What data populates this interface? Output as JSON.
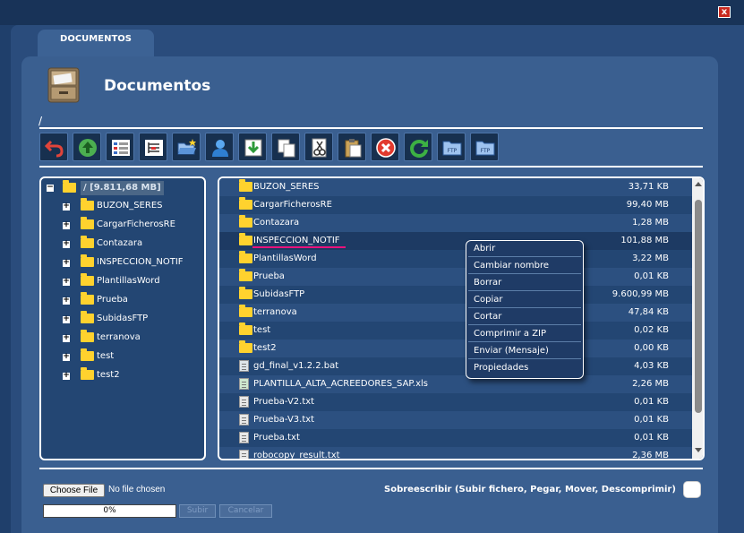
{
  "window": {
    "close_glyph": "x"
  },
  "tab": {
    "label": "DOCUMENTOS"
  },
  "header": {
    "title": "Documentos",
    "icon": "file-cabinet-icon"
  },
  "path": "/",
  "toolbar": [
    {
      "name": "back",
      "icon": "undo-arrow-icon"
    },
    {
      "name": "up",
      "icon": "up-arrow-icon"
    },
    {
      "name": "view-details",
      "icon": "details-view-icon"
    },
    {
      "name": "view-list",
      "icon": "list-view-icon"
    },
    {
      "name": "open-folder",
      "icon": "open-folder-icon"
    },
    {
      "name": "user",
      "icon": "user-icon"
    },
    {
      "name": "download",
      "icon": "download-icon"
    },
    {
      "name": "copy",
      "icon": "copy-icon"
    },
    {
      "name": "cut",
      "icon": "scissors-icon"
    },
    {
      "name": "paste",
      "icon": "paste-icon"
    },
    {
      "name": "delete",
      "icon": "delete-icon"
    },
    {
      "name": "refresh",
      "icon": "refresh-icon"
    },
    {
      "name": "ftp-1",
      "icon": "ftp-folder-icon",
      "label": "FTP"
    },
    {
      "name": "ftp-2",
      "icon": "ftp-folder-icon",
      "label": "FTP"
    }
  ],
  "tree": {
    "root_label": "/ [9.811,68 MB]",
    "expand_glyph": "+",
    "collapse_glyph": "−",
    "items": [
      "BUZON_SERES",
      "CargarFicherosRE",
      "Contazara",
      "INSPECCION_NOTIF",
      "PlantillasWord",
      "Prueba",
      "SubidasFTP",
      "terranova",
      "test",
      "test2"
    ]
  },
  "files": [
    {
      "name": "BUZON_SERES",
      "size": "33,71 KB",
      "type": "folder"
    },
    {
      "name": "CargarFicherosRE",
      "size": "99,40 MB",
      "type": "folder"
    },
    {
      "name": "Contazara",
      "size": "1,28 MB",
      "type": "folder"
    },
    {
      "name": "INSPECCION_NOTIF",
      "size": "101,88 MB",
      "type": "folder",
      "selected": true
    },
    {
      "name": "PlantillasWord",
      "size": "3,22 MB",
      "type": "folder"
    },
    {
      "name": "Prueba",
      "size": "0,01 KB",
      "type": "folder"
    },
    {
      "name": "SubidasFTP",
      "size": "9.600,99 MB",
      "type": "folder"
    },
    {
      "name": "terranova",
      "size": "47,84 KB",
      "type": "folder"
    },
    {
      "name": "test",
      "size": "0,02 KB",
      "type": "folder"
    },
    {
      "name": "test2",
      "size": "0,00 KB",
      "type": "folder"
    },
    {
      "name": "gd_final_v1.2.2.bat",
      "size": "4,03 KB",
      "type": "bat"
    },
    {
      "name": "PLANTILLA_ALTA_ACREEDORES_SAP.xls",
      "size": "2,26 MB",
      "type": "xls"
    },
    {
      "name": "Prueba-V2.txt",
      "size": "0,01 KB",
      "type": "txt"
    },
    {
      "name": "Prueba-V3.txt",
      "size": "0,01 KB",
      "type": "txt"
    },
    {
      "name": "Prueba.txt",
      "size": "0,01 KB",
      "type": "txt"
    },
    {
      "name": "robocopy_result.txt",
      "size": "2,36 MB",
      "type": "txt"
    }
  ],
  "context_menu": [
    "Abrir",
    "Cambiar nombre",
    "Borrar",
    "Copiar",
    "Cortar",
    "Comprimir a ZIP",
    "Enviar (Mensaje)",
    "Propiedades"
  ],
  "upload": {
    "choose_label": "Choose File",
    "no_file": "No file chosen",
    "progress": "0%",
    "progress_value": 0,
    "submit_label": "Subir",
    "cancel_label": "Cancelar",
    "overwrite_label": "Sobreescribir (Subir fichero, Pegar, Mover, Descomprimir)",
    "overwrite_checked": false
  },
  "colors": {
    "background": "#1f3f6b",
    "panel": "#3a5f90",
    "folder": "#ffd22e",
    "highlight_underline": "#e8127c",
    "close": "#c8281e"
  }
}
